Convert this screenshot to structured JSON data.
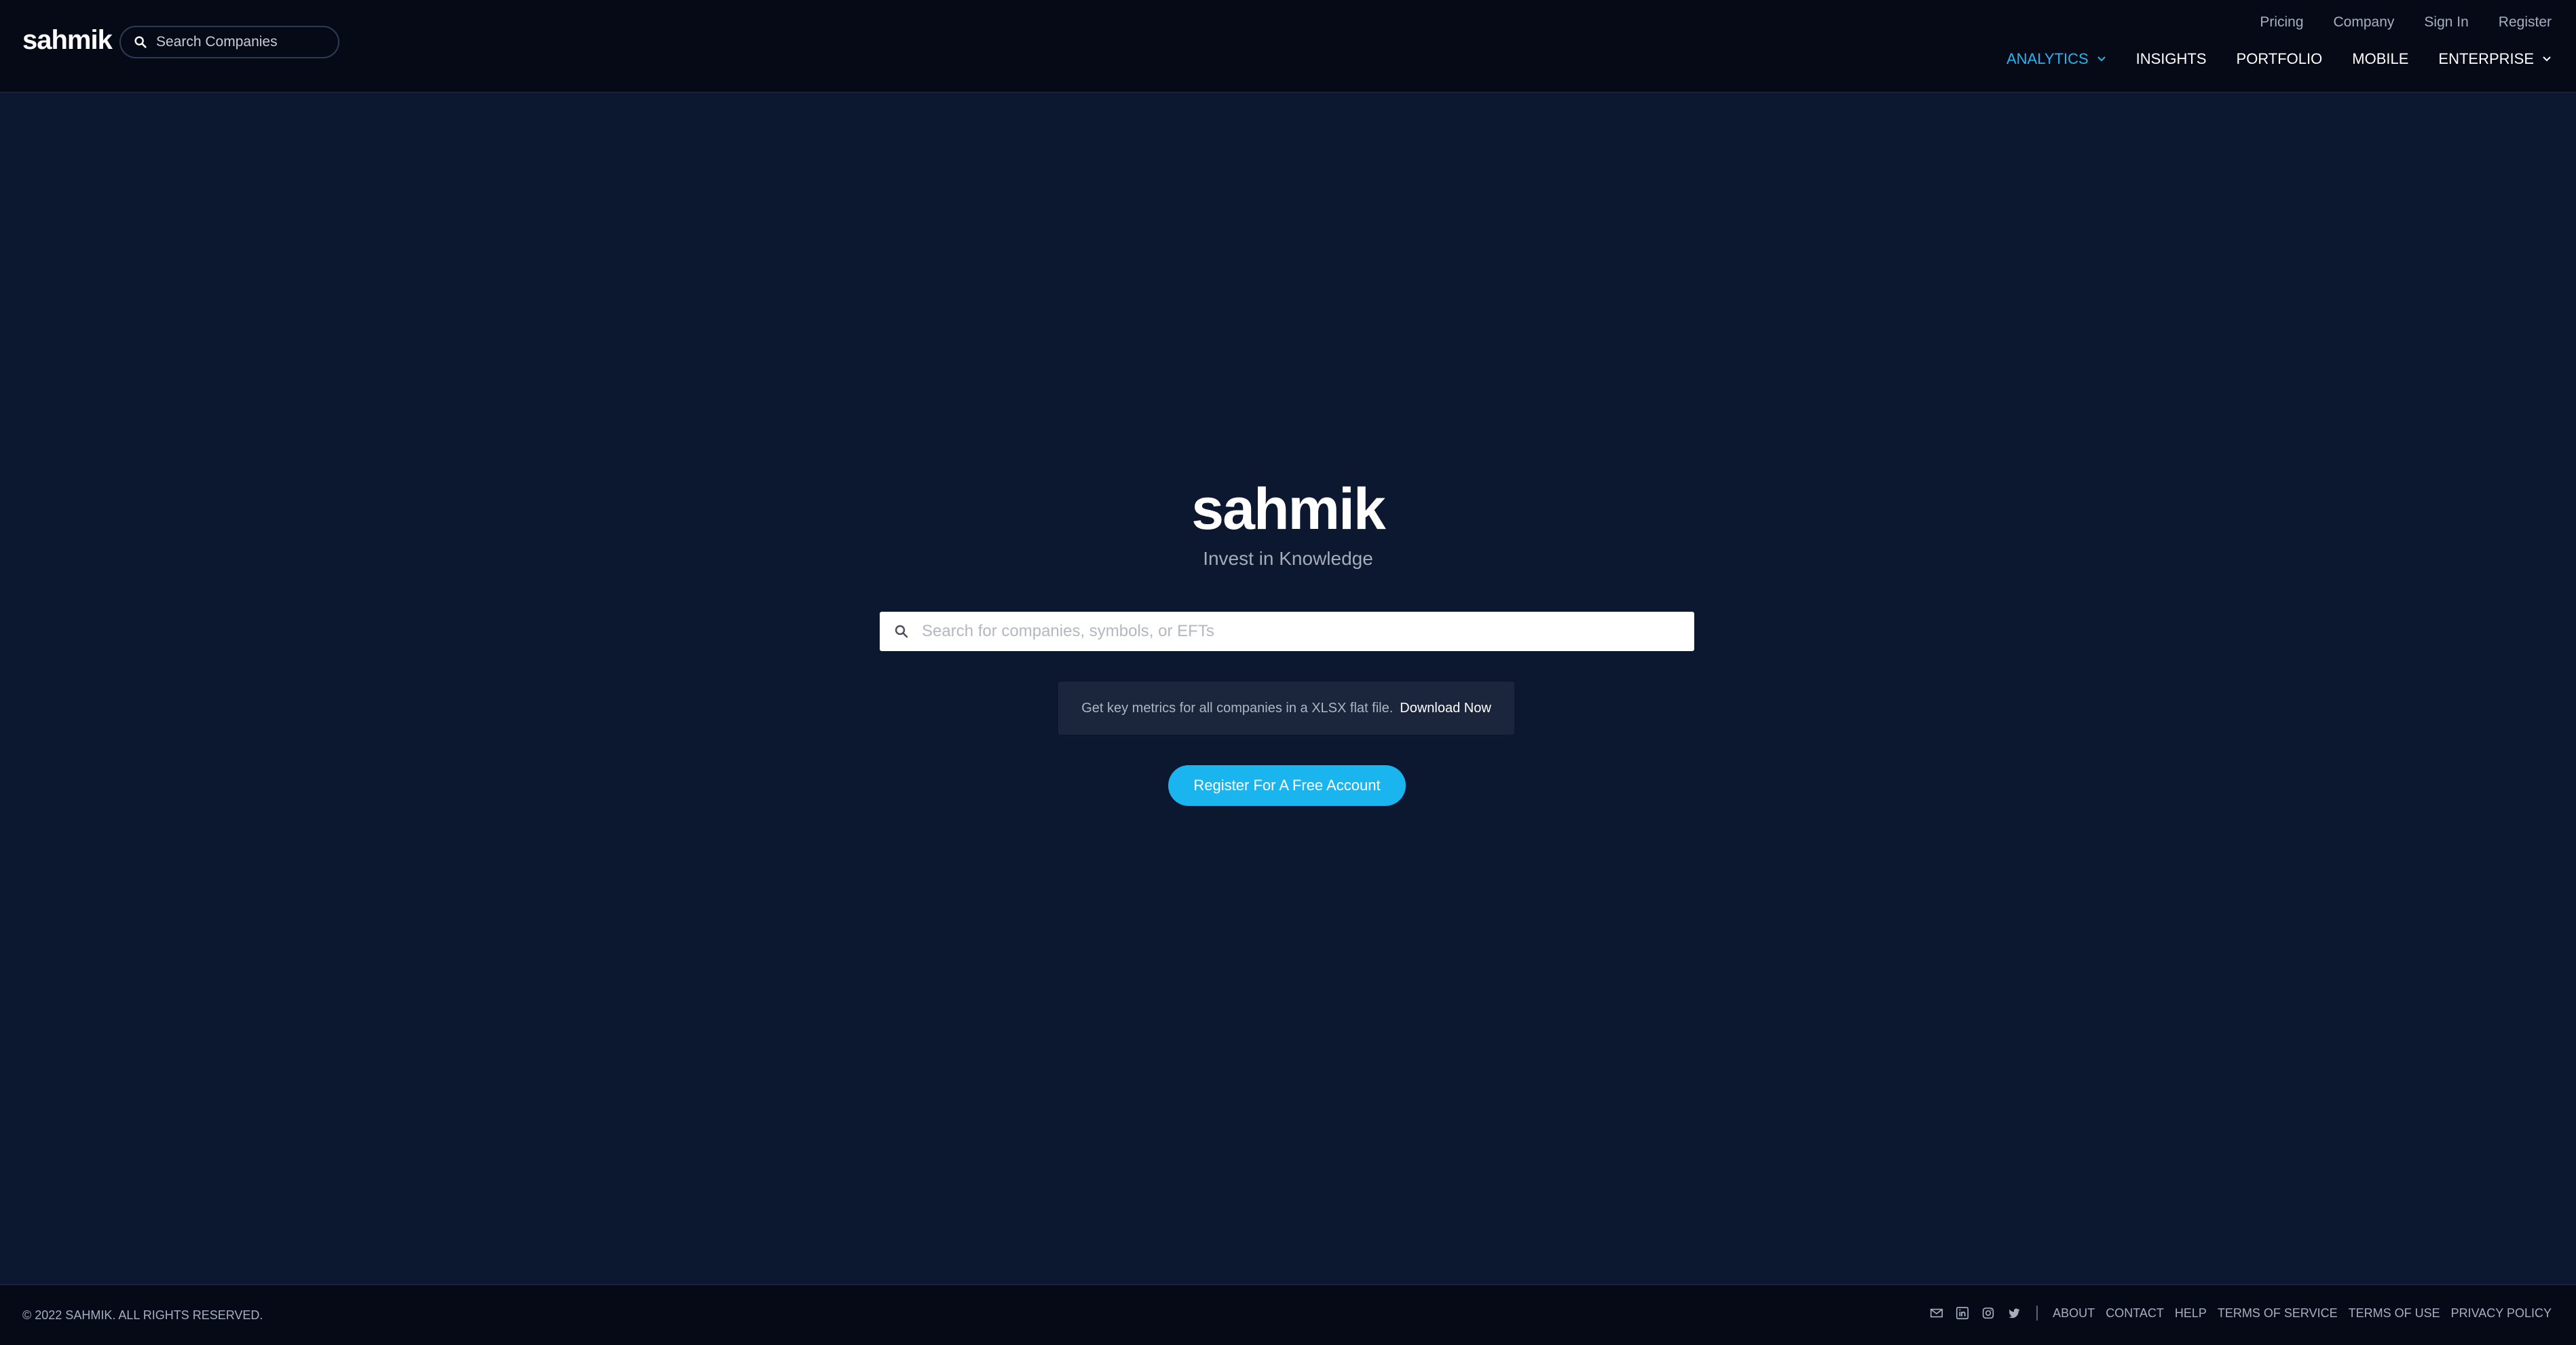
{
  "header": {
    "logo": "sahmik",
    "search_placeholder": "Search Companies",
    "top_links": [
      "Pricing",
      "Company",
      "Sign In",
      "Register"
    ],
    "nav": {
      "analytics": "ANALYTICS",
      "insights": "INSIGHTS",
      "portfolio": "PORTFOLIO",
      "mobile": "MOBILE",
      "enterprise": "ENTERPRISE"
    }
  },
  "hero": {
    "logo_left": "sahm",
    "logo_right": "ik",
    "tagline": "Invest in Knowledge",
    "search_placeholder": "Search for companies, symbols, or EFTs",
    "promo_text": "Get key metrics for all companies in a XLSX flat file.",
    "promo_link": "Download Now",
    "register_label": "Register For A Free Account"
  },
  "footer": {
    "copyright": "© 2022 SAHMIK. ALL RIGHTS RESERVED.",
    "icons": [
      "mail-icon",
      "linkedin-icon",
      "instagram-icon",
      "twitter-icon"
    ],
    "links": [
      "ABOUT",
      "CONTACT",
      "HELP",
      "TERMS OF SERVICE",
      "TERMS OF USE",
      "PRIVACY POLICY"
    ]
  },
  "colors": {
    "background": "#0c1830",
    "header_bg": "#050a16",
    "accent": "#1ab4ef",
    "active_nav": "#25b6f0"
  }
}
